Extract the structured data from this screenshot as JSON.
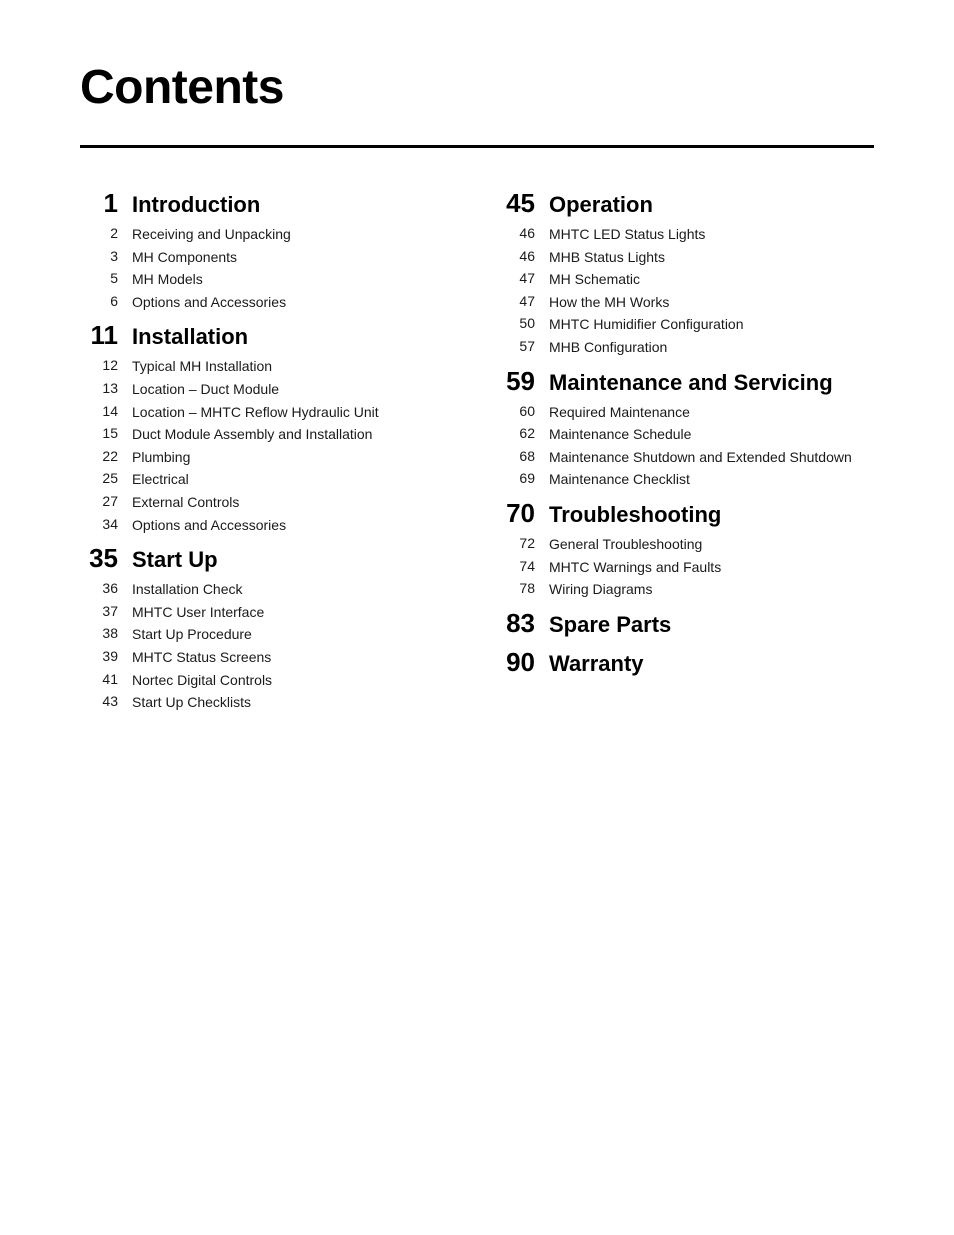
{
  "title": "Contents",
  "left_column": {
    "sections": [
      {
        "number": "1",
        "label": "Introduction",
        "items": [
          {
            "number": "2",
            "label": "Receiving and Unpacking"
          },
          {
            "number": "3",
            "label": "MH Components"
          },
          {
            "number": "5",
            "label": "MH Models"
          },
          {
            "number": "6",
            "label": "Options and Accessories"
          }
        ]
      },
      {
        "number": "11",
        "label": "Installation",
        "items": [
          {
            "number": "12",
            "label": "Typical MH Installation"
          },
          {
            "number": "13",
            "label": "Location – Duct Module"
          },
          {
            "number": "14",
            "label": "Location – MHTC Reflow Hydraulic Unit"
          },
          {
            "number": "15",
            "label": "Duct Module Assembly and Installation"
          },
          {
            "number": "22",
            "label": "Plumbing"
          },
          {
            "number": "25",
            "label": "Electrical"
          },
          {
            "number": "27",
            "label": "External Controls"
          },
          {
            "number": "34",
            "label": "Options and Accessories"
          }
        ]
      },
      {
        "number": "35",
        "label": "Start Up",
        "items": [
          {
            "number": "36",
            "label": "Installation Check"
          },
          {
            "number": "37",
            "label": "MHTC User Interface"
          },
          {
            "number": "38",
            "label": "Start Up Procedure"
          },
          {
            "number": "39",
            "label": "MHTC Status Screens"
          },
          {
            "number": "41",
            "label": "Nortec Digital Controls"
          },
          {
            "number": "43",
            "label": "Start Up Checklists"
          }
        ]
      }
    ]
  },
  "right_column": {
    "sections": [
      {
        "number": "45",
        "label": "Operation",
        "items": [
          {
            "number": "46",
            "label": "MHTC LED Status Lights"
          },
          {
            "number": "46",
            "label": "MHB Status Lights"
          },
          {
            "number": "47",
            "label": "MH Schematic"
          },
          {
            "number": "47",
            "label": "How the MH Works"
          },
          {
            "number": "50",
            "label": "MHTC Humidifier Configuration"
          },
          {
            "number": "57",
            "label": "MHB Configuration"
          }
        ]
      },
      {
        "number": "59",
        "label": "Maintenance and Servicing",
        "items": [
          {
            "number": "60",
            "label": "Required Maintenance"
          },
          {
            "number": "62",
            "label": "Maintenance Schedule"
          },
          {
            "number": "68",
            "label": "Maintenance Shutdown and Extended Shutdown"
          },
          {
            "number": "69",
            "label": "Maintenance Checklist"
          }
        ]
      },
      {
        "number": "70",
        "label": "Troubleshooting",
        "items": [
          {
            "number": "72",
            "label": "General Troubleshooting"
          },
          {
            "number": "74",
            "label": "MHTC Warnings and Faults"
          },
          {
            "number": "78",
            "label": "Wiring Diagrams"
          }
        ]
      },
      {
        "number": "83",
        "label": "Spare Parts",
        "items": []
      },
      {
        "number": "90",
        "label": "Warranty",
        "items": []
      }
    ]
  }
}
